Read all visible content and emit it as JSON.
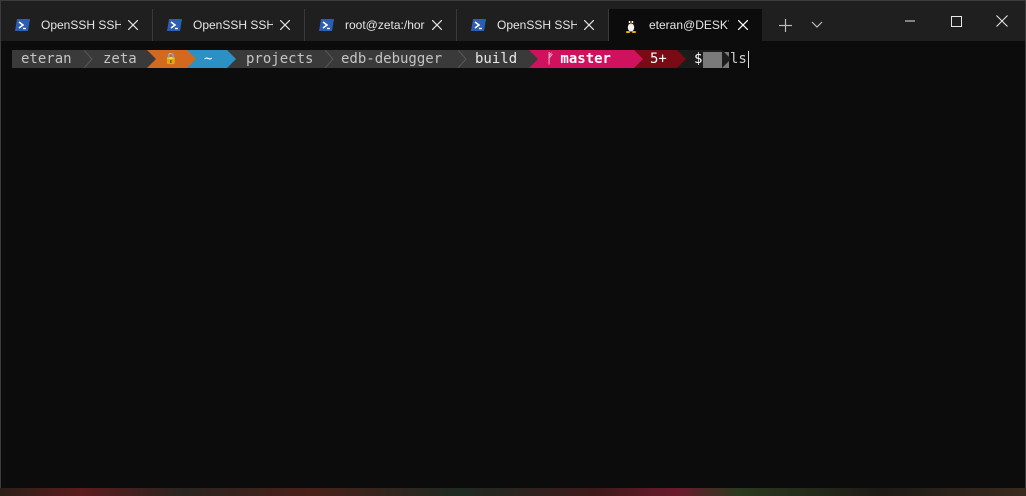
{
  "tabs": [
    {
      "label": "OpenSSH SSH c",
      "icon": "powershell-icon",
      "active": false
    },
    {
      "label": "OpenSSH SSH c",
      "icon": "powershell-icon",
      "active": false
    },
    {
      "label": "root@zeta:/hor",
      "icon": "powershell-icon",
      "active": false
    },
    {
      "label": "OpenSSH SSH c",
      "icon": "powershell-icon",
      "active": false
    },
    {
      "label": "eteran@DESKTO",
      "icon": "linux-tux-icon",
      "active": true
    }
  ],
  "titlebar": {
    "new_tab_icon": "plus-icon",
    "dropdown_icon": "chevron-down-icon",
    "minimize_icon": "minimize-icon",
    "maximize_icon": "maximize-icon",
    "close_icon": "close-icon"
  },
  "prompt": {
    "user": "eteran",
    "host": "zeta",
    "lock_glyph": "🔒",
    "home": "~",
    "dirs": [
      "projects",
      "edb-debugger",
      "build"
    ],
    "git_branch_glyph": "ᚠ",
    "git_branch": "master",
    "git_status": "5+",
    "symbol": "$"
  },
  "command": "ls",
  "colors": {
    "tab_bar": "#1f1f1f",
    "terminal_bg": "#0c0c0c",
    "segment_gray": "#3a3a3a",
    "lock_orange": "#d2691e",
    "home_blue": "#2b90c4",
    "git_pink": "#d0115e",
    "status_maroon": "#7a0b14",
    "symbol_dark": "#1c1c1c",
    "powershell_blue": "#2a5fb4"
  }
}
